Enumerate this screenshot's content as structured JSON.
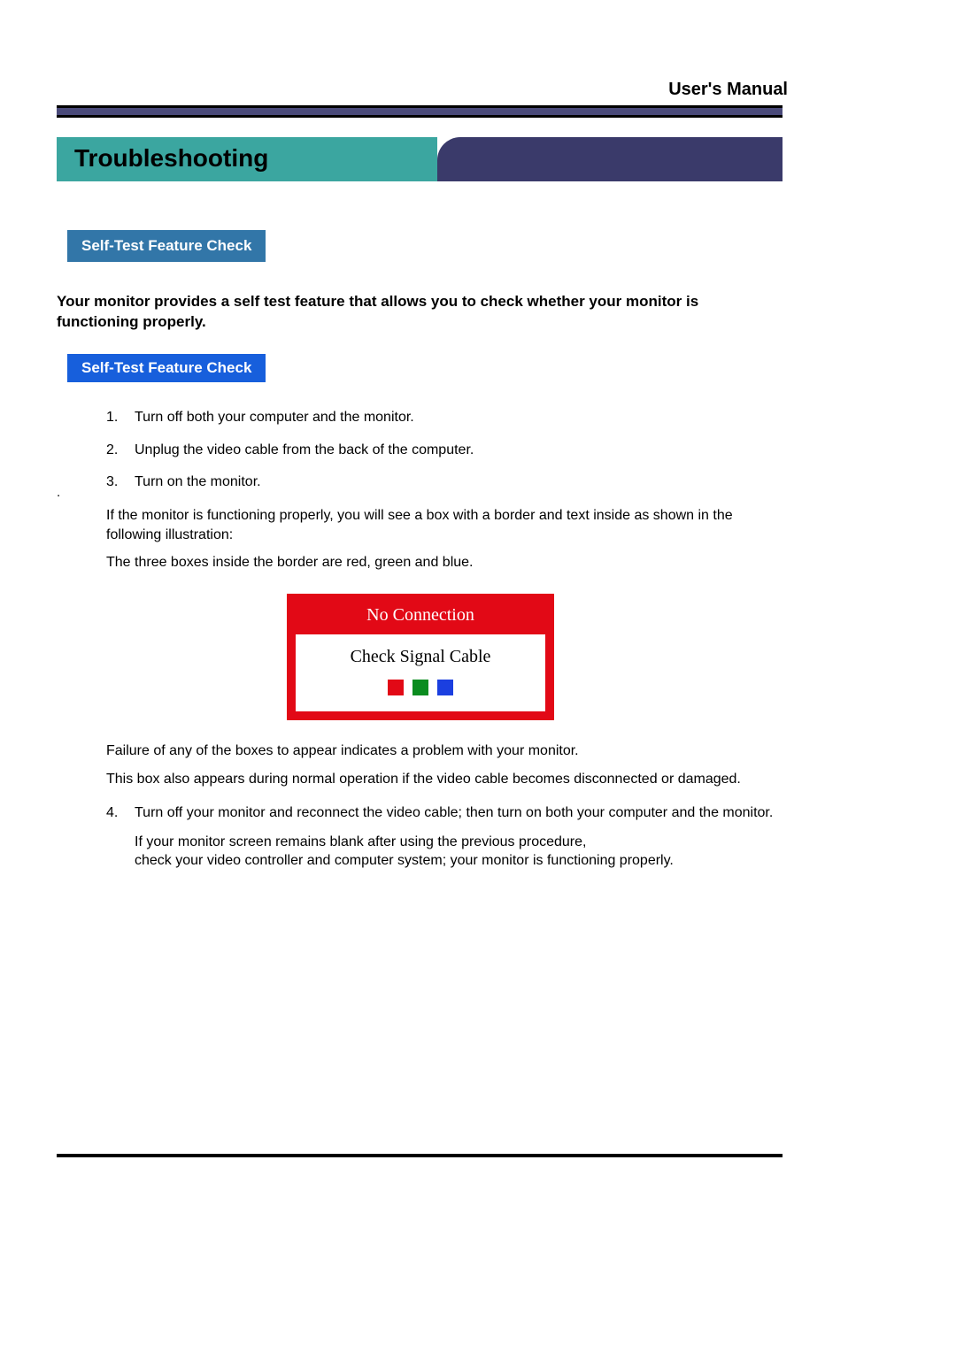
{
  "header": {
    "label": "User's Manual"
  },
  "section": {
    "title": "Troubleshooting"
  },
  "badge1": "Self-Test Feature Check",
  "intro": "Your monitor provides a self test feature that allows you to check whether your monitor is functioning properly.",
  "badge2": "Self-Test Feature Check",
  "stray": ".",
  "steps": {
    "s1": "Turn off both your computer and the monitor.",
    "s2": "Unplug the video cable from the back of the computer.",
    "s3": "Turn on the monitor."
  },
  "para_after3a": "If the monitor is functioning properly, you will see a box with a border and  text inside as shown in the following illustration:",
  "para_after3b": "The three boxes inside the border are red, green and blue.",
  "illustration": {
    "title": "No Connection",
    "text": "Check Signal Cable",
    "colors": {
      "red": "#e20916",
      "green": "#0a8c1f",
      "blue": "#1b3fe0"
    }
  },
  "para_after_illa": "Failure of any of the boxes to appear indicates a problem with your monitor.",
  "para_after_illb": "This box also appears during normal operation if the video cable becomes disconnected or damaged.",
  "step4": "Turn off your monitor and reconnect the video cable; then turn on both your computer and the monitor.",
  "step4_sub_a": "If your monitor screen remains blank after using the previous procedure,",
  "step4_sub_b": "check your video controller and computer system; your monitor is functioning properly."
}
